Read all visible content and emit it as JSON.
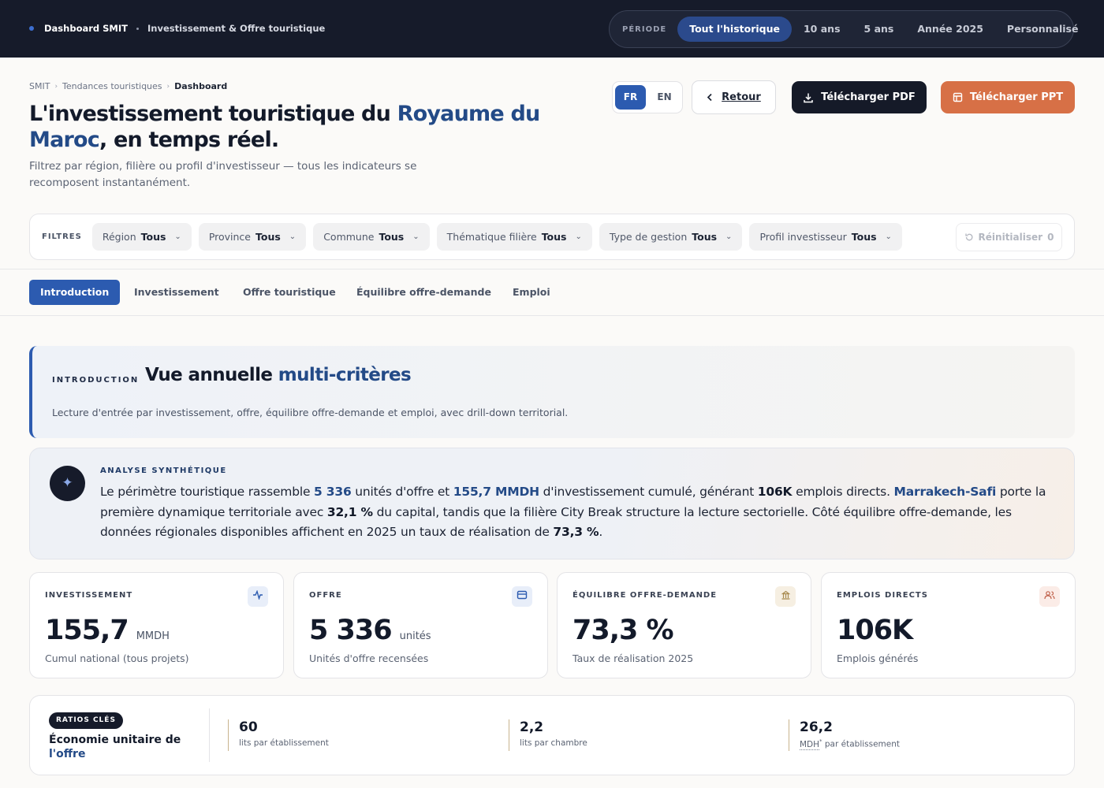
{
  "topbar": {
    "brand": "Dashboard SMIT",
    "section": "Investissement & Offre touristique",
    "period_label": "PÉRIODE",
    "periods": [
      "Tout l'historique",
      "10 ans",
      "5 ans",
      "Année 2025",
      "Personnalisé"
    ],
    "active_period": "Tout l'historique"
  },
  "breadcrumb": [
    "SMIT",
    "Tendances touristiques",
    "Dashboard"
  ],
  "header": {
    "title_a": "L'investissement touristique du ",
    "title_hl": "Royaume du Maroc",
    "title_b": ", en temps réel.",
    "subtitle": "Filtrez par région, filière ou profil d'investisseur — tous les indicateurs se recomposent instantanément."
  },
  "lang": {
    "fr": "FR",
    "en": "EN",
    "active": "FR"
  },
  "actions": {
    "back": "Retour",
    "pdf": "Télécharger PDF",
    "ppt": "Télécharger PPT"
  },
  "filters": {
    "label": "FILTRES",
    "items": [
      {
        "name": "Région",
        "value": "Tous"
      },
      {
        "name": "Province",
        "value": "Tous"
      },
      {
        "name": "Commune",
        "value": "Tous"
      },
      {
        "name": "Thématique filière",
        "value": "Tous"
      },
      {
        "name": "Type de gestion",
        "value": "Tous"
      },
      {
        "name": "Profil investisseur",
        "value": "Tous"
      }
    ],
    "reset": "Réinitialiser",
    "reset_count": "0"
  },
  "tabs": [
    "Introduction",
    "Investissement",
    "Offre touristique",
    "Équilibre offre-demande",
    "Emploi"
  ],
  "active_tab": "Introduction",
  "intro": {
    "kicker": "INTRODUCTION",
    "heading_a": "Vue annuelle ",
    "heading_hl": "multi-critères",
    "description": "Lecture d'entrée par investissement, offre, équilibre offre-demande et emploi, avec drill-down territorial."
  },
  "synthesis": {
    "kicker": "ANALYSE SYNTHÉTIQUE",
    "t1": "Le périmètre touristique rassemble ",
    "v1": "5 336",
    "t2": " unités d'offre et ",
    "v2": "155,7 MMDH",
    "t3": " d'investissement cumulé, générant ",
    "v3": "106K",
    "t4": " emplois directs. ",
    "v4": "Marrakech-Safi",
    "t5": " porte la première dynamique territoriale avec ",
    "v5": "32,1 %",
    "t6": " du capital, tandis que la filière City Break structure la lecture sectorielle. Côté équilibre offre-demande, les données régionales disponibles affichent en 2025 un taux de réalisation de ",
    "v6": "73,3 %",
    "t7": "."
  },
  "kpis": [
    {
      "label": "INVESTISSEMENT",
      "value": "155,7",
      "unit": "MMDH",
      "desc": "Cumul national (tous projets)",
      "icon": "activity-icon",
      "color": "#2c5bb0",
      "bg": "#e8eef9"
    },
    {
      "label": "OFFRE",
      "value": "5 336",
      "unit": "unités",
      "desc": "Unités d'offre recensées",
      "icon": "card-icon",
      "color": "#2c5bb0",
      "bg": "#e8eef9"
    },
    {
      "label": "ÉQUILIBRE OFFRE-DEMANDE",
      "value": "73,3 %",
      "unit": "",
      "desc": "Taux de réalisation 2025",
      "icon": "building-icon",
      "color": "#a88a4f",
      "bg": "#f6efe2"
    },
    {
      "label": "EMPLOIS DIRECTS",
      "value": "106K",
      "unit": "",
      "desc": "Emplois générés",
      "icon": "users-icon",
      "color": "#c0604a",
      "bg": "#fbece7"
    }
  ],
  "ratios": {
    "badge": "RATIOS CLÉS",
    "title_a": "Économie unitaire de ",
    "title_hl": "l'offre",
    "items": [
      {
        "value": "60",
        "label": "lits par établissement"
      },
      {
        "value": "2,2",
        "label": "lits par chambre"
      },
      {
        "value": "26,2",
        "unit": "MDH",
        "label": " par établissement"
      }
    ]
  }
}
